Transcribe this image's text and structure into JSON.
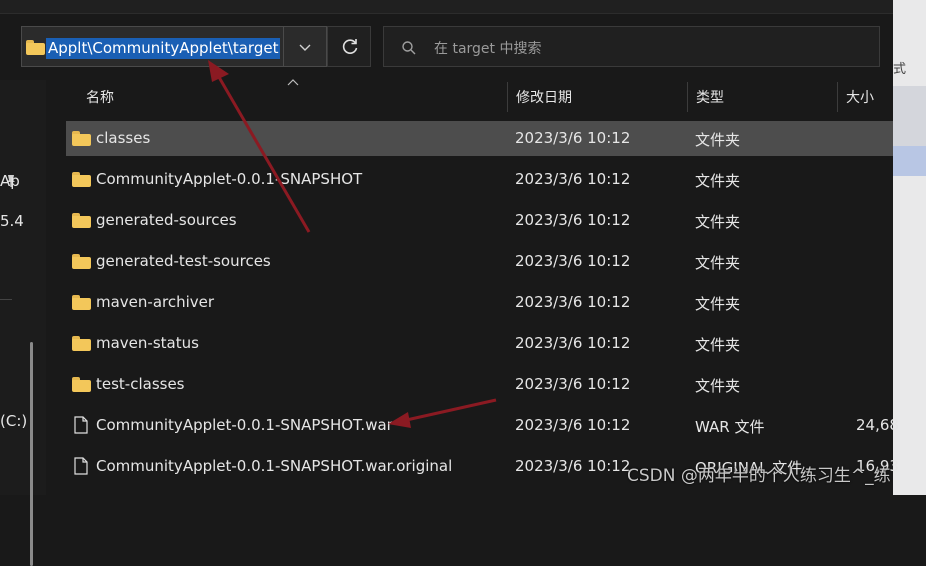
{
  "address_bar": {
    "path": "Applt\\CommunityApplet\\target"
  },
  "search": {
    "placeholder": "在 target 中搜索"
  },
  "nav": {
    "items": [
      {
        "label": "Ap"
      },
      {
        "label": "5.4"
      },
      {
        "label": "(C:)"
      }
    ]
  },
  "side_glyph": "式",
  "columns": {
    "name": "名称",
    "date": "修改日期",
    "type": "类型",
    "size": "大小"
  },
  "files": [
    {
      "name": "classes",
      "date": "2023/3/6 10:12",
      "type": "文件夹",
      "size": "",
      "icon": "folder-icon"
    },
    {
      "name": "CommunityApplet-0.0.1-SNAPSHOT",
      "date": "2023/3/6 10:12",
      "type": "文件夹",
      "size": "",
      "icon": "folder-icon"
    },
    {
      "name": "generated-sources",
      "date": "2023/3/6 10:12",
      "type": "文件夹",
      "size": "",
      "icon": "folder-icon"
    },
    {
      "name": "generated-test-sources",
      "date": "2023/3/6 10:12",
      "type": "文件夹",
      "size": "",
      "icon": "folder-icon"
    },
    {
      "name": "maven-archiver",
      "date": "2023/3/6 10:12",
      "type": "文件夹",
      "size": "",
      "icon": "folder-icon"
    },
    {
      "name": "maven-status",
      "date": "2023/3/6 10:12",
      "type": "文件夹",
      "size": "",
      "icon": "folder-icon"
    },
    {
      "name": "test-classes",
      "date": "2023/3/6 10:12",
      "type": "文件夹",
      "size": "",
      "icon": "folder-icon"
    },
    {
      "name": "CommunityApplet-0.0.1-SNAPSHOT.war",
      "date": "2023/3/6 10:12",
      "type": "WAR 文件",
      "size": "24,68",
      "icon": "file-icon"
    },
    {
      "name": "CommunityApplet-0.0.1-SNAPSHOT.war.original",
      "date": "2023/3/6 10:12",
      "type": "ORIGINAL 文件",
      "size": "16,93",
      "icon": "file-icon"
    }
  ],
  "watermark": "CSDN @两年半的个人练习生^_练",
  "colors": {
    "selection": "#1a5fb4",
    "row_selected": "#4d4d4d",
    "annotation_arrow": "#8b1a22",
    "folder": "#f3c75a"
  }
}
